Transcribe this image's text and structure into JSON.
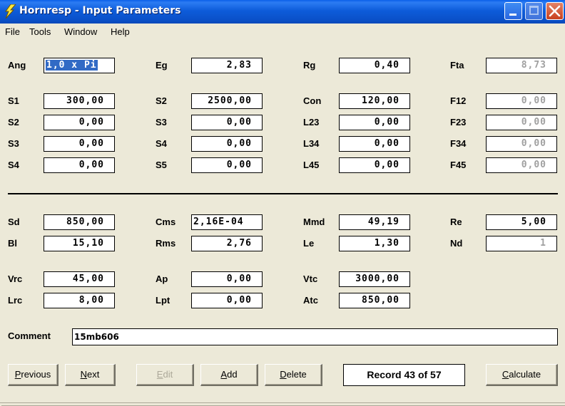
{
  "window": {
    "title": "Hornresp - Input Parameters",
    "icon": "lightning-bolt-icon",
    "controls": [
      "minimize",
      "maximize",
      "close"
    ]
  },
  "menu": [
    "File",
    "Tools",
    "Window",
    "Help"
  ],
  "top_section": {
    "row0": [
      {
        "label": "Ang",
        "value": "1,0 x Pi",
        "selected": true,
        "enabled": true
      },
      {
        "label": "Eg",
        "value": "2,83",
        "enabled": true
      },
      {
        "label": "Rg",
        "value": "0,40",
        "enabled": true
      },
      {
        "label": "Fta",
        "value": "8,73",
        "enabled": false
      }
    ],
    "grid": [
      [
        {
          "label": "S1",
          "value": "300,00"
        },
        {
          "label": "S2",
          "value": "2500,00"
        },
        {
          "label": "Con",
          "value": "120,00"
        },
        {
          "label": "F12",
          "value": "0,00",
          "enabled": false
        }
      ],
      [
        {
          "label": "S2",
          "value": "0,00"
        },
        {
          "label": "S3",
          "value": "0,00"
        },
        {
          "label": "L23",
          "value": "0,00"
        },
        {
          "label": "F23",
          "value": "0,00",
          "enabled": false
        }
      ],
      [
        {
          "label": "S3",
          "value": "0,00"
        },
        {
          "label": "S4",
          "value": "0,00"
        },
        {
          "label": "L34",
          "value": "0,00"
        },
        {
          "label": "F34",
          "value": "0,00",
          "enabled": false
        }
      ],
      [
        {
          "label": "S4",
          "value": "0,00"
        },
        {
          "label": "S5",
          "value": "0,00"
        },
        {
          "label": "L45",
          "value": "0,00"
        },
        {
          "label": "F45",
          "value": "0,00",
          "enabled": false
        }
      ]
    ]
  },
  "driver_section": {
    "row1": [
      {
        "label": "Sd",
        "value": "850,00"
      },
      {
        "label": "Cms",
        "value": "2,16E-04"
      },
      {
        "label": "Mmd",
        "value": "49,19"
      },
      {
        "label": "Re",
        "value": "5,00"
      }
    ],
    "row2": [
      {
        "label": "Bl",
        "value": "15,10"
      },
      {
        "label": "Rms",
        "value": "2,76"
      },
      {
        "label": "Le",
        "value": "1,30"
      },
      {
        "label": "Nd",
        "value": "1",
        "enabled": false
      }
    ],
    "row3": [
      {
        "label": "Vrc",
        "value": "45,00"
      },
      {
        "label": "Ap",
        "value": "0,00"
      },
      {
        "label": "Vtc",
        "value": "3000,00"
      }
    ],
    "row4": [
      {
        "label": "Lrc",
        "value": "8,00"
      },
      {
        "label": "Lpt",
        "value": "0,00"
      },
      {
        "label": "Atc",
        "value": "850,00"
      }
    ]
  },
  "comment": {
    "label": "Comment",
    "value": "15mb606"
  },
  "buttons": {
    "previous": {
      "accel": "P",
      "rest": "revious"
    },
    "next": {
      "accel": "N",
      "rest": "ext"
    },
    "edit": {
      "accel": "E",
      "rest": "dit",
      "enabled": false
    },
    "add": {
      "accel": "A",
      "rest": "dd"
    },
    "delete": {
      "accel": "D",
      "rest": "elete"
    },
    "calculate": {
      "accel": "C",
      "rest": "alculate"
    }
  },
  "record_status": "Record 43 of 57"
}
